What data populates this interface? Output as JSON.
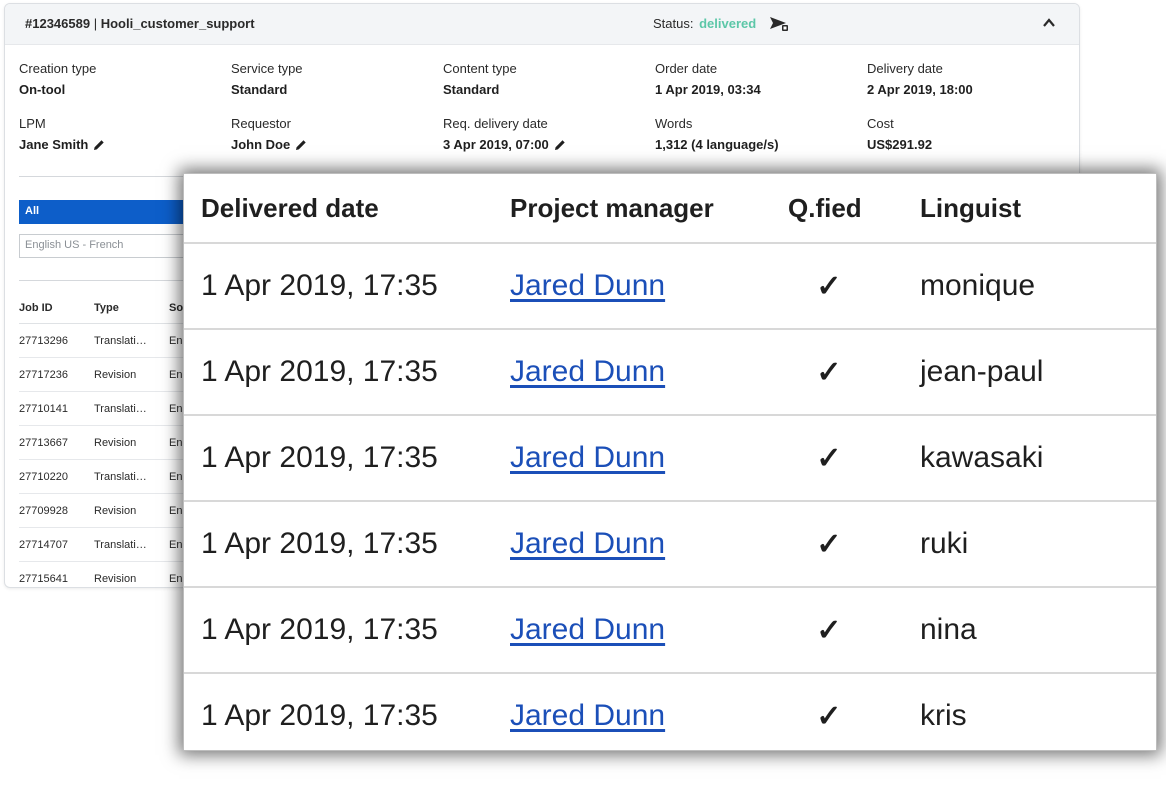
{
  "order": {
    "id": "#12346589",
    "separator": "|",
    "name": "Hooli_customer_support",
    "status_label": "Status:",
    "status_value": "delivered",
    "status_color": "#5cc7a8"
  },
  "details": [
    {
      "label": "Creation type",
      "value": "On-tool"
    },
    {
      "label": "Service type",
      "value": "Standard"
    },
    {
      "label": "Content type",
      "value": "Standard"
    },
    {
      "label": "Order date",
      "value": "1 Apr 2019, 03:34"
    },
    {
      "label": "Delivery date",
      "value": "2 Apr 2019, 18:00"
    },
    {
      "label": "LPM",
      "value": "Jane Smith"
    },
    {
      "label": "Requestor",
      "value": "John Doe"
    },
    {
      "label": "Req. delivery date",
      "value": "3 Apr 2019, 07:00"
    },
    {
      "label": "Words",
      "value": "1,312 (4 language/s)"
    },
    {
      "label": "Cost",
      "value": "US$291.92"
    }
  ],
  "filter": {
    "all_label": "All",
    "language_value": "English US - French",
    "accent_color": "#0d5ec9"
  },
  "jobs": {
    "headers": [
      "Job ID",
      "Type",
      "So"
    ],
    "rows": [
      [
        "27713296",
        "Translati…",
        "En"
      ],
      [
        "27717236",
        "Revision",
        "En"
      ],
      [
        "27710141",
        "Translati…",
        "En"
      ],
      [
        "27713667",
        "Revision",
        "En"
      ],
      [
        "27710220",
        "Translati…",
        "En"
      ],
      [
        "27709928",
        "Revision",
        "En"
      ],
      [
        "27714707",
        "Translati…",
        "En"
      ],
      [
        "27715641",
        "Revision",
        "En"
      ]
    ]
  },
  "delivered_table": {
    "headers": [
      "Delivered date",
      "Project manager",
      "Q.fied",
      "Linguist"
    ],
    "rows": [
      {
        "date": "1 Apr 2019, 17:35",
        "pm": "Jared Dunn",
        "qualified": "✓",
        "linguist": "monique"
      },
      {
        "date": "1 Apr 2019, 17:35",
        "pm": "Jared Dunn",
        "qualified": "✓",
        "linguist": "jean-paul"
      },
      {
        "date": "1 Apr 2019, 17:35",
        "pm": "Jared Dunn",
        "qualified": "✓",
        "linguist": "kawasaki"
      },
      {
        "date": "1 Apr 2019, 17:35",
        "pm": "Jared Dunn",
        "qualified": "✓",
        "linguist": "ruki"
      },
      {
        "date": "1 Apr 2019, 17:35",
        "pm": "Jared Dunn",
        "qualified": "✓",
        "linguist": "nina"
      },
      {
        "date": "1 Apr 2019, 17:35",
        "pm": "Jared Dunn",
        "qualified": "✓",
        "linguist": "kris"
      }
    ]
  },
  "icons": {
    "status": "send-icon",
    "collapse": "chevron-up-icon",
    "edit": "pencil-icon"
  }
}
